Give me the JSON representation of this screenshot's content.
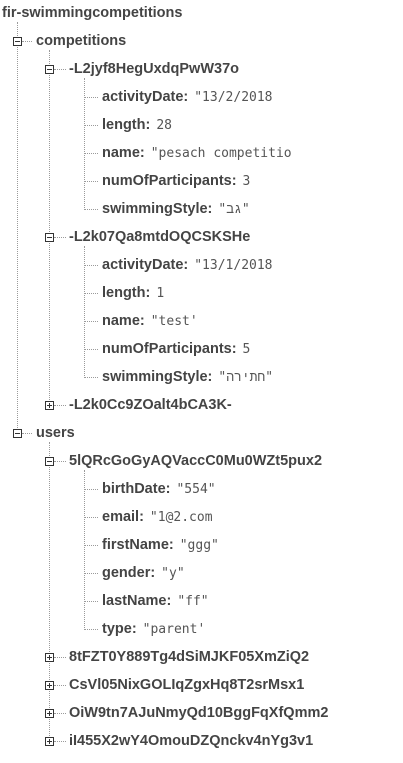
{
  "root": {
    "label": "fir-swimmingcompetitions",
    "children": [
      {
        "label": "competitions",
        "children": [
          {
            "label": "-L2jyf8HegUxdqPwW37o",
            "fields": [
              {
                "key": "activityDate:",
                "value": "\"13/2/2018"
              },
              {
                "key": "length:",
                "value": "28"
              },
              {
                "key": "name:",
                "value": "\"pesach competitio"
              },
              {
                "key": "numOfParticipants:",
                "value": "3"
              },
              {
                "key": "swimmingStyle:",
                "value": "\"גב\""
              }
            ]
          },
          {
            "label": "-L2k07Qa8mtdOQCSKSHe",
            "fields": [
              {
                "key": "activityDate:",
                "value": "\"13/1/2018"
              },
              {
                "key": "length:",
                "value": "1"
              },
              {
                "key": "name:",
                "value": "\"test'"
              },
              {
                "key": "numOfParticipants:",
                "value": "5"
              },
              {
                "key": "swimmingStyle:",
                "value": "\"חתירה\""
              }
            ]
          },
          {
            "label": "-L2k0Cc9ZOalt4bCA3K-",
            "collapsed": true
          }
        ]
      },
      {
        "label": "users",
        "children": [
          {
            "label": "5lQRcGoGyAQVaccC0Mu0WZt5pux2",
            "fields": [
              {
                "key": "birthDate:",
                "value": "\"554\""
              },
              {
                "key": "email:",
                "value": "\"1@2.com"
              },
              {
                "key": "firstName:",
                "value": "\"ggg\""
              },
              {
                "key": "gender:",
                "value": "\"y\""
              },
              {
                "key": "lastName:",
                "value": "\"ff\""
              },
              {
                "key": "type:",
                "value": "\"parent'"
              }
            ]
          },
          {
            "label": "8tFZT0Y889Tg4dSiMJKF05XmZiQ2",
            "collapsed": true
          },
          {
            "label": "CsVl05NixGOLIqZgxHq8T2srMsx1",
            "collapsed": true
          },
          {
            "label": "OiW9tn7AJuNmyQd10BggFqXfQmm2",
            "collapsed": true
          },
          {
            "label": "iI455X2wY4OmouDZQnckv4nYg3v1",
            "collapsed": true
          }
        ]
      }
    ]
  }
}
